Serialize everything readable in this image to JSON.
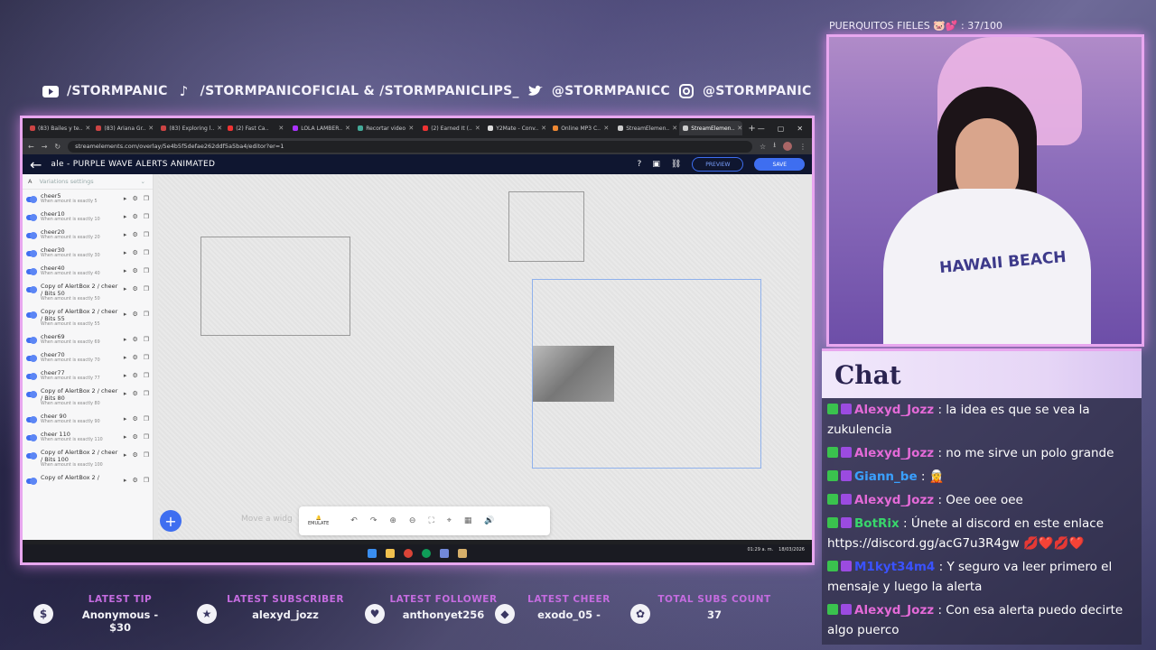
{
  "socials": [
    {
      "icon": "youtube-icon",
      "text": "/STORMPANIC"
    },
    {
      "icon": "tiktok-icon",
      "text": "/STORMPANICOFICIAL & /STORMPANICLIPS_"
    },
    {
      "icon": "twitter-icon",
      "text": "@STORMPANICC"
    },
    {
      "icon": "instagram-icon",
      "text": "@STORMPANIC"
    }
  ],
  "browser": {
    "tabs": [
      "(83) Bailes y te..",
      "(83) Ariana Gr..",
      "(83) Exploring l..",
      "(2) Fast Ca..",
      "LOLA LAMBER..",
      "Recortar video",
      "(2) Earned It (..",
      "Y2Mate - Conv..",
      "Online MP3 C..",
      "StreamElemen..",
      "StreamElemen.."
    ],
    "url": "streamelements.com/overlay/5e4b5f5defae262ddf5a5ba4/editor?er=1",
    "app_title": "ale - PURPLE WAVE ALERTS ANIMATED",
    "preview_label": "PREVIEW",
    "save_label": "SAVE",
    "panel_title": "Variations settings",
    "variations": [
      {
        "name": "cheer5",
        "sub": "When amount is exactly 5"
      },
      {
        "name": "cheer10",
        "sub": "When amount is exactly 10"
      },
      {
        "name": "cheer20",
        "sub": "When amount is exactly 20"
      },
      {
        "name": "cheer30",
        "sub": "When amount is exactly 30"
      },
      {
        "name": "cheer40",
        "sub": "When amount is exactly 40"
      },
      {
        "name": "Copy of AlertBox 2 / cheer / Bits 50",
        "sub": "When amount is exactly 50"
      },
      {
        "name": "Copy of AlertBox 2 / cheer / Bits 55",
        "sub": "When amount is exactly 55"
      },
      {
        "name": "cheer69",
        "sub": "When amount is exactly 69"
      },
      {
        "name": "cheer70",
        "sub": "When amount is exactly 70"
      },
      {
        "name": "cheer77",
        "sub": "When amount is exactly 77"
      },
      {
        "name": "Copy of AlertBox 2 / cheer / Bits 80",
        "sub": "When amount is exactly 80"
      },
      {
        "name": "cheer 90",
        "sub": "When amount is exactly 90"
      },
      {
        "name": "cheer 110",
        "sub": "When amount is exactly 110"
      },
      {
        "name": "Copy of AlertBox 2 / cheer / Bits 100",
        "sub": "When amount is exactly 100"
      },
      {
        "name": "Copy of AlertBox 2 /",
        "sub": ""
      }
    ],
    "canvas_hint": "Move a widg",
    "emulate_label": "EMULATE",
    "clock_time": "01:29 a. m.",
    "clock_date": "18/03/2026"
  },
  "webcam": {
    "title": "PUERQUITOS FIELES 🐷💕 : 37/100",
    "shirt_text": "HAWAII BEACH"
  },
  "chat": {
    "title": "Chat",
    "messages": [
      {
        "user": "Alexyd_Jozz",
        "color": "#e46ad8",
        "text": " : la idea es que se vea la zukulencia"
      },
      {
        "user": "Alexyd_Jozz",
        "color": "#e46ad8",
        "text": " : no me sirve un polo grande"
      },
      {
        "user": "Giann_be",
        "color": "#3aa0ff",
        "text": " : 🧝"
      },
      {
        "user": "Alexyd_Jozz",
        "color": "#e46ad8",
        "text": " : Oee oee oee"
      },
      {
        "user": "BotRix",
        "color": "#38d66b",
        "text": " : Únete al discord en este enlace https://discord.gg/acG7u3R4gw 💋❤️💋❤️"
      },
      {
        "user": "M1kyt34m4",
        "color": "#3a52ff",
        "text": " : Y seguro va leer primero el mensaje y luego la alerta"
      },
      {
        "user": "Alexyd_Jozz",
        "color": "#e46ad8",
        "text": " : Con esa alerta puedo decirte algo puerco"
      }
    ]
  },
  "stats": [
    {
      "icon": "dollar-icon",
      "label": "LATEST TIP",
      "value": "Anonymous - $30"
    },
    {
      "icon": "star-icon",
      "label": "LATEST SUBSCRIBER",
      "value": "alexyd_jozz"
    },
    {
      "icon": "heart-icon",
      "label": "LATEST FOLLOWER",
      "value": "anthonyet256"
    },
    {
      "icon": "gem-icon",
      "label": "LATEST CHEER",
      "value": "exodo_05 -"
    },
    {
      "icon": "paw-icon",
      "label": "TOTAL SUBS COUNT",
      "value": "37"
    }
  ],
  "colors": {
    "accent": "#e8a7ef",
    "stat_label": "#c56ce0",
    "save_button": "#3e6ef0"
  }
}
